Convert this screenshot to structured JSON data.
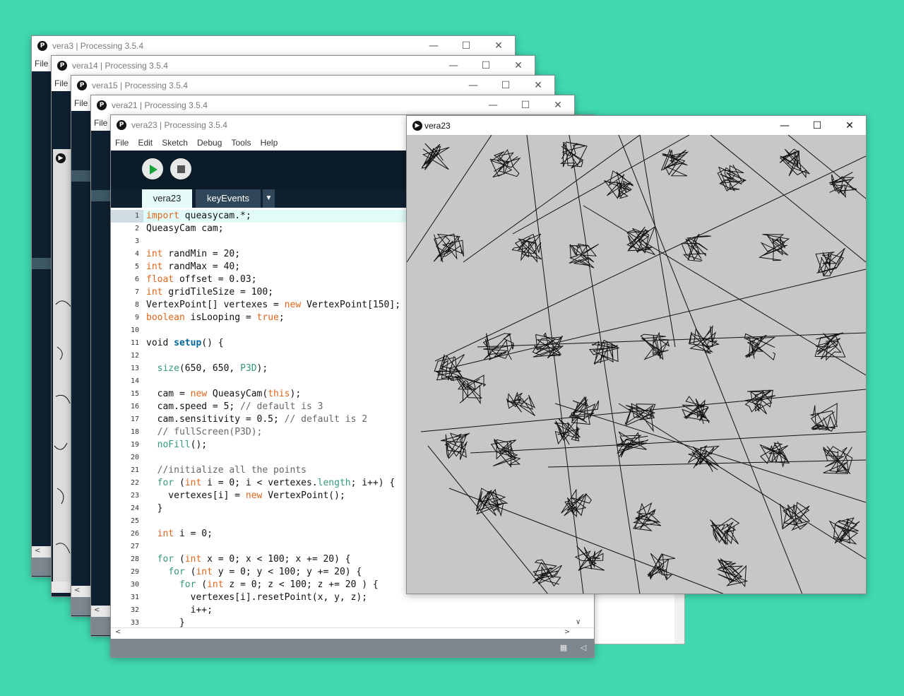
{
  "menu": [
    "File",
    "Edit",
    "Sketch",
    "Debug",
    "Tools",
    "Help"
  ],
  "bg_windows": [
    {
      "title": "vera3 | Processing 3.5.4",
      "menu_file": "File"
    },
    {
      "title": "vera14 | Processing 3.5.4",
      "menu_file": "File"
    },
    {
      "title": "vera15 | Processing 3.5.4",
      "menu_file": "File"
    },
    {
      "title": "vera21 | Processing 3.5.4",
      "menu_file": "File"
    }
  ],
  "editor": {
    "title": "vera23 | Processing 3.5.4",
    "tabs": {
      "active": "vera23",
      "other": "keyEvents",
      "more": "▼"
    },
    "code": [
      "import queasycam.*;",
      "QueasyCam cam;",
      "",
      "int randMin = 20;",
      "int randMax = 40;",
      "float offset = 0.03;",
      "int gridTileSize = 100;",
      "VertexPoint[] vertexes = new VertexPoint[150];",
      "boolean isLooping = true;",
      "",
      "void setup() {",
      "",
      "  size(650, 650, P3D);",
      "",
      "  cam = new QueasyCam(this);",
      "  cam.speed = 5; // default is 3",
      "  cam.sensitivity = 0.5; // default is 2",
      "  // fullScreen(P3D);",
      "  noFill();",
      "",
      "  //initialize all the points",
      "  for (int i = 0; i < vertexes.length; i++) {",
      "    vertexes[i] = new VertexPoint();",
      "  }",
      "",
      "  int i = 0;",
      "",
      "  for (int x = 0; x < 100; x += 20) {",
      "    for (int y = 0; y < 100; y += 20) {",
      "      for (int z = 0; z < 100; z += 20 ) {",
      "        vertexes[i].resetPoint(x, y, z);",
      "        i++;",
      "      }"
    ]
  },
  "sketch": {
    "title": "vera23"
  },
  "colors": {
    "background": "#40d8b0",
    "editor_dark": "#0f2030",
    "tab_active": "#e5fcf8",
    "canvas": "#c7c7c7",
    "run_green": "#1aa33b"
  }
}
